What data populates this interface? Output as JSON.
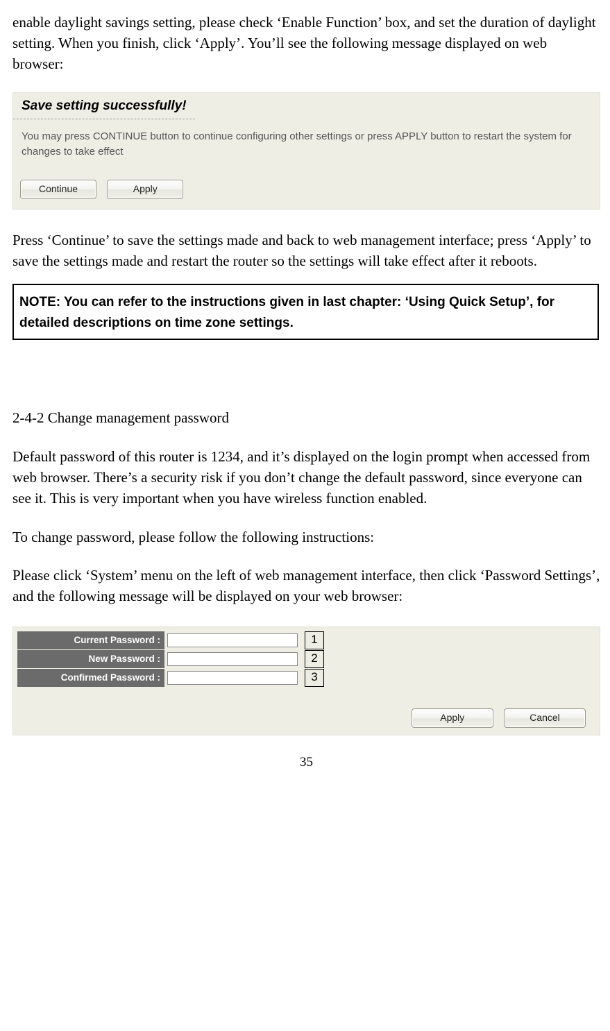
{
  "intro": "enable daylight savings setting, please check ‘Enable Function’ box, and set the duration of daylight setting. When you finish, click ‘Apply’. You’ll see the following message displayed on web browser:",
  "shot1": {
    "title": "Save setting successfully!",
    "message": "You may press CONTINUE button to continue configuring other settings or press APPLY button to restart the system for changes to take effect",
    "continue": "Continue",
    "apply": "Apply"
  },
  "after_shot1": "Press ‘Continue’ to save the settings made and back to web management interface; press ‘Apply’ to save the settings made and restart the router so the settings will take effect after it reboots.",
  "note": "NOTE: You can refer to the instructions given in last chapter: ‘Using Quick Setup’, for detailed descriptions on time zone settings.",
  "heading": "2-4-2 Change management password",
  "p2": "Default password of this router is 1234, and it’s displayed on the login prompt when accessed from web browser. There’s a security risk if you don’t change the default password, since everyone can see it. This is very important when you have wireless function enabled.",
  "p3": "To change password, please follow the following instructions:",
  "p4": "Please click ‘System’ menu on the left of web management interface, then click ‘Password Settings’, and the following message will be displayed on your web browser:",
  "pwform": {
    "rows": [
      {
        "label": "Current Password :",
        "num": "1"
      },
      {
        "label": "New Password :",
        "num": "2"
      },
      {
        "label": "Confirmed Password :",
        "num": "3"
      }
    ],
    "apply": "Apply",
    "cancel": "Cancel"
  },
  "page_number": "35"
}
